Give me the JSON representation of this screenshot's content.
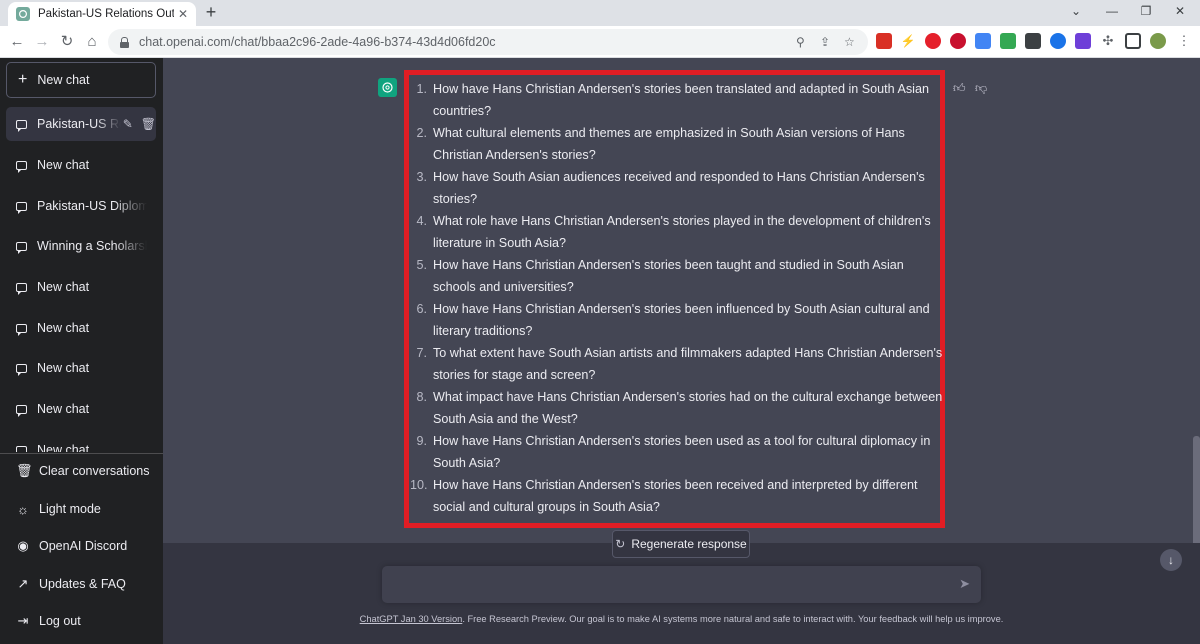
{
  "browser": {
    "tab_title": "Pakistan-US Relations Outline",
    "url": "chat.openai.com/chat/bbaa2c96-2ade-4a96-b374-43d4d06fd20c"
  },
  "sidebar": {
    "new_chat": "New chat",
    "conversations": [
      {
        "label": "Pakistan-US Re",
        "active": true
      },
      {
        "label": "New chat"
      },
      {
        "label": "Pakistan-US Diplomati"
      },
      {
        "label": "Winning a Scholarship"
      },
      {
        "label": "New chat"
      },
      {
        "label": "New chat"
      },
      {
        "label": "New chat"
      },
      {
        "label": "New chat"
      },
      {
        "label": "New chat"
      }
    ],
    "bottom": {
      "clear": "Clear conversations",
      "light": "Light mode",
      "discord": "OpenAI Discord",
      "updates": "Updates & FAQ",
      "logout": "Log out"
    }
  },
  "response": {
    "items": [
      {
        "n": "1.",
        "text": "How have Hans Christian Andersen's stories been translated and adapted in South Asian countries?"
      },
      {
        "n": "2.",
        "text": "What cultural elements and themes are emphasized in South Asian versions of Hans Christian Andersen's stories?"
      },
      {
        "n": "3.",
        "text": "How have South Asian audiences received and responded to Hans Christian Andersen's stories?"
      },
      {
        "n": "4.",
        "text": "What role have Hans Christian Andersen's stories played in the development of children's literature in South Asia?"
      },
      {
        "n": "5.",
        "text": "How have Hans Christian Andersen's stories been taught and studied in South Asian schools and universities?"
      },
      {
        "n": "6.",
        "text": "How have Hans Christian Andersen's stories been influenced by South Asian cultural and literary traditions?"
      },
      {
        "n": "7.",
        "text": "To what extent have South Asian artists and filmmakers adapted Hans Christian Andersen's stories for stage and screen?"
      },
      {
        "n": "8.",
        "text": "What impact have Hans Christian Andersen's stories had on the cultural exchange between South Asia and the West?"
      },
      {
        "n": "9.",
        "text": "How have Hans Christian Andersen's stories been used as a tool for cultural diplomacy in South Asia?"
      },
      {
        "n": "10.",
        "text": "How have Hans Christian Andersen's stories been received and interpreted by different social and cultural groups in South Asia?"
      }
    ]
  },
  "composer": {
    "regenerate": "Regenerate response",
    "input_value": "",
    "footer_link": "ChatGPT Jan 30 Version",
    "footer_text": ". Free Research Preview. Our goal is to make AI systems more natural and safe to interact with. Your feedback will help us improve."
  },
  "colors": {
    "sidebar_bg": "#202123",
    "main_bg": "#444654",
    "composer_bg": "#343541",
    "accent": "#10a37f",
    "highlight": "#e11d24"
  }
}
